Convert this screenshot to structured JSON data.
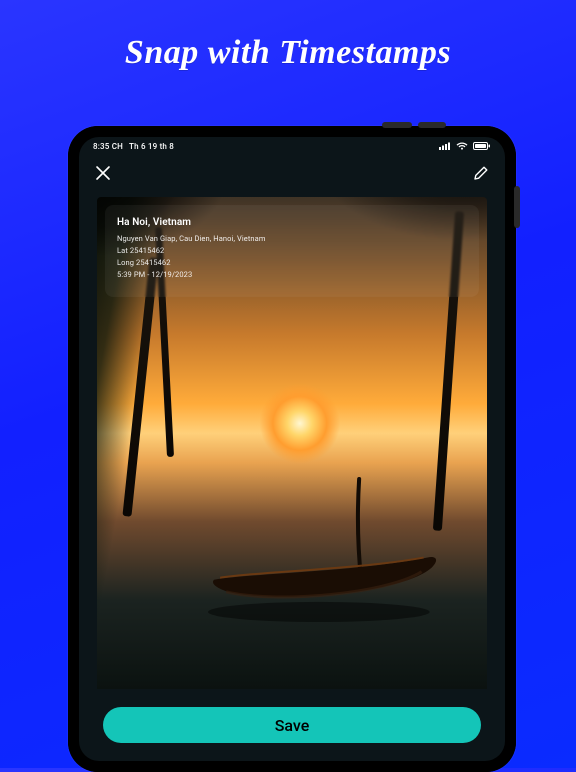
{
  "headline": "Snap with Timestamps",
  "statusbar": {
    "time": "8:35 CH",
    "date": "Th 6 19 th 8"
  },
  "stamp": {
    "location": "Ha Noi, Vietnam",
    "address": "Nguyen Van Giap, Cau Dien, Hanoi, Vietnam",
    "lat_label": "Lat 25415462",
    "long_label": "Long 25415462",
    "datetime": "5:39 PM - 12/19/2023"
  },
  "buttons": {
    "save": "Save"
  }
}
